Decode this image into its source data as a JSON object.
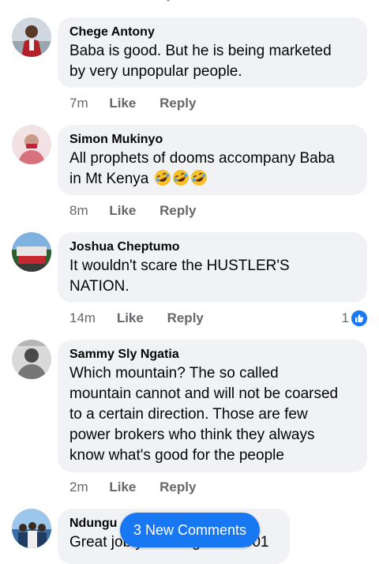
{
  "comments": [
    {
      "name": "Chege Antony",
      "text_lines": [
        "Baba is good. But he is being marketed",
        "by very unpopular people."
      ],
      "time": "7m",
      "like_label": "Like",
      "reply_label": "Reply"
    },
    {
      "name": "Simon Mukinyo",
      "text_lines": [
        "All prophets of dooms accompany Baba",
        "in Mt Kenya"
      ],
      "emoji": [
        "rolling-on-floor-laughing",
        "rolling-on-floor-laughing",
        "rolling-on-floor-laughing"
      ],
      "time": "8m",
      "like_label": "Like",
      "reply_label": "Reply"
    },
    {
      "name": "Joshua Cheptumo",
      "text_lines": [
        "It wouldn't scare the HUSTLER'S",
        "NATION."
      ],
      "time": "14m",
      "like_label": "Like",
      "reply_label": "Reply",
      "reaction_count": "1",
      "reaction_icon": "thumbs-up-icon"
    },
    {
      "name": "Sammy Sly Ngatia",
      "text_lines": [
        "Which mountain? The so called",
        "mountain cannot and will not be coarsed",
        "to a certain direction. Those are few",
        "power brokers who think they always",
        "know what's good for the people"
      ],
      "time": "2m",
      "like_label": "Like",
      "reply_label": "Reply"
    },
    {
      "name": "Ndungu",
      "text_lines": [
        "Great job you doing Kenn 001"
      ]
    }
  ],
  "new_comments_button": "3 New Comments",
  "colors": {
    "accent": "#1877f2",
    "bubble": "#f0f2f5",
    "meta_text": "#65676b"
  }
}
